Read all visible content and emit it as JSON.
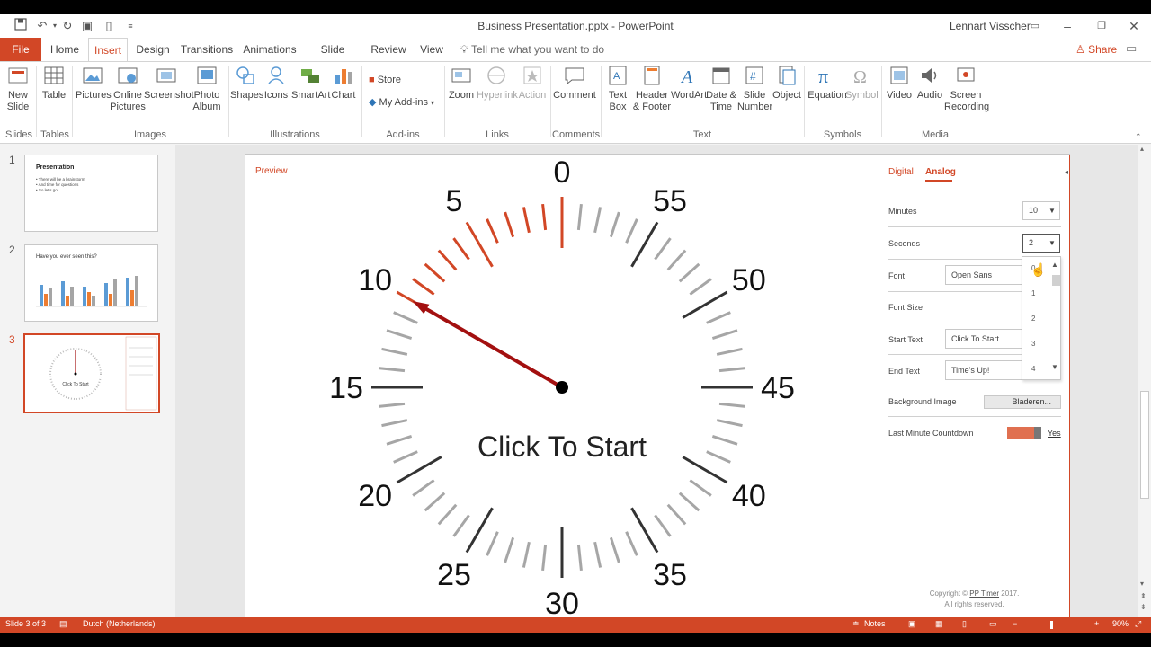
{
  "window": {
    "title": "Business Presentation.pptx  -  PowerPoint",
    "user": "Lennart Visscher"
  },
  "tabs": {
    "file": "File",
    "home": "Home",
    "insert": "Insert",
    "design": "Design",
    "transitions": "Transitions",
    "animations": "Animations",
    "slideshow": "Slide Show",
    "review": "Review",
    "view": "View",
    "tell": "Tell me what you want to do",
    "share": "Share"
  },
  "ribbon": {
    "new_slide": "New Slide",
    "table": "Table",
    "pictures": "Pictures",
    "online_pictures": "Online Pictures",
    "screenshot": "Screenshot",
    "photo_album": "Photo Album",
    "shapes": "Shapes",
    "icons": "Icons",
    "smartart": "SmartArt",
    "chart": "Chart",
    "store": "Store",
    "my_addins": "My Add-ins",
    "zoom": "Zoom",
    "hyperlink": "Hyperlink",
    "action": "Action",
    "comment": "Comment",
    "text_box": "Text Box",
    "header_footer": "Header & Footer",
    "wordart": "WordArt",
    "date_time": "Date & Time",
    "slide_number": "Slide Number",
    "object": "Object",
    "equation": "Equation",
    "symbol": "Symbol",
    "video": "Video",
    "audio": "Audio",
    "screen_recording": "Screen Recording",
    "groups": {
      "slides": "Slides",
      "tables": "Tables",
      "images": "Images",
      "illustrations": "Illustrations",
      "addins": "Add-ins",
      "links": "Links",
      "comments": "Comments",
      "text": "Text",
      "symbols": "Symbols",
      "media": "Media"
    }
  },
  "thumbnails": [
    {
      "num": "1",
      "title": "Presentation",
      "bullets": [
        "• There will be a brainstorm",
        "• And time for questions",
        "• So let's go!"
      ]
    },
    {
      "num": "2",
      "title": "Have you ever seen this?"
    },
    {
      "num": "3",
      "title": "Click To Start"
    }
  ],
  "clock": {
    "preview_label": "Preview",
    "center_text": "Click To Start",
    "numbers": [
      "0",
      "5",
      "10",
      "15",
      "20",
      "25",
      "30",
      "35",
      "40",
      "45",
      "50",
      "55"
    ],
    "hand_minute": 10,
    "colors": {
      "accent": "#d24726",
      "hand": "#a31010",
      "tick_major": "#333333",
      "tick_minor": "#a6a6a6"
    }
  },
  "panel": {
    "tab_digital": "Digital",
    "tab_analog": "Analog",
    "minutes_label": "Minutes",
    "minutes_value": "10",
    "seconds_label": "Seconds",
    "seconds_value": "2",
    "font_label": "Font",
    "font_value": "Open Sans",
    "font_size_label": "Font Size",
    "start_text_label": "Start Text",
    "start_text_value": "Click To Start",
    "end_text_label": "End Text",
    "end_text_value": "Time's Up!",
    "bg_image_label": "Background Image",
    "browse_button": "Bladeren...",
    "last_minute_label": "Last Minute Countdown",
    "last_minute_value": "Yes",
    "copyright_pre": "Copyright ©",
    "copyright_link": "PP Timer",
    "copyright_year": "2017.",
    "rights": "All rights reserved.",
    "dropdown_options": [
      "0",
      "1",
      "2",
      "3",
      "4"
    ]
  },
  "status": {
    "slide": "Slide 3 of 3",
    "language": "Dutch (Netherlands)",
    "notes": "Notes",
    "zoom": "90%"
  }
}
